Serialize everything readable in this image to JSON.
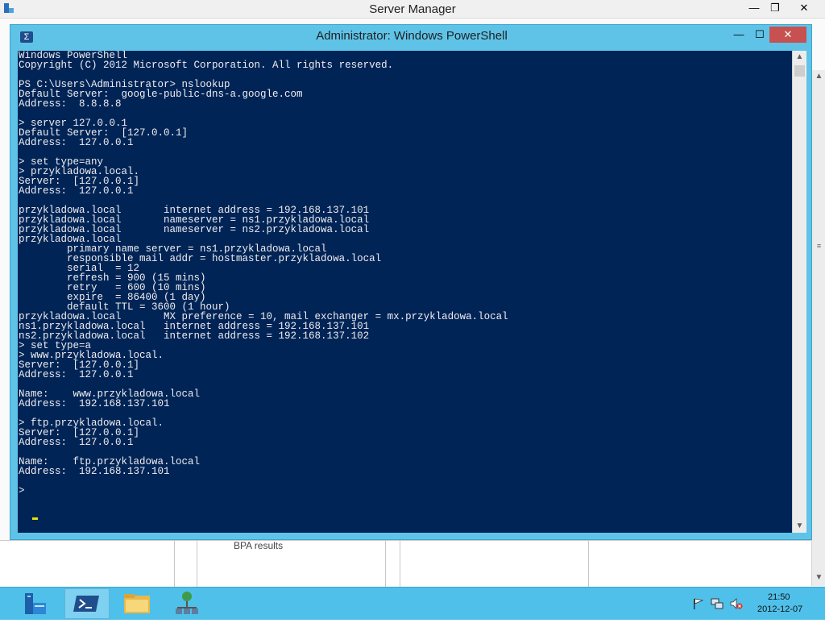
{
  "server_manager": {
    "title": "Server Manager",
    "minimize_glyph": "—",
    "restore_glyph": "❐",
    "close_glyph": "✕",
    "bpa_results": "BPA results"
  },
  "powershell": {
    "title": "Administrator: Windows PowerShell",
    "minimize_glyph": "—",
    "maximize_glyph": "☐",
    "close_glyph": "✕",
    "icon_glyph": "Σ",
    "console_lines": [
      "Windows PowerShell",
      "Copyright (C) 2012 Microsoft Corporation. All rights reserved.",
      "",
      "PS C:\\Users\\Administrator> nslookup",
      "Default Server:  google-public-dns-a.google.com",
      "Address:  8.8.8.8",
      "",
      "> server 127.0.0.1",
      "Default Server:  [127.0.0.1]",
      "Address:  127.0.0.1",
      "",
      "> set type=any",
      "> przykladowa.local.",
      "Server:  [127.0.0.1]",
      "Address:  127.0.0.1",
      "",
      "przykladowa.local       internet address = 192.168.137.101",
      "przykladowa.local       nameserver = ns1.przykladowa.local",
      "przykladowa.local       nameserver = ns2.przykladowa.local",
      "przykladowa.local",
      "        primary name server = ns1.przykladowa.local",
      "        responsible mail addr = hostmaster.przykladowa.local",
      "        serial  = 12",
      "        refresh = 900 (15 mins)",
      "        retry   = 600 (10 mins)",
      "        expire  = 86400 (1 day)",
      "        default TTL = 3600 (1 hour)",
      "przykladowa.local       MX preference = 10, mail exchanger = mx.przykladowa.local",
      "ns1.przykladowa.local   internet address = 192.168.137.101",
      "ns2.przykladowa.local   internet address = 192.168.137.102",
      "> set type=a",
      "> www.przykladowa.local.",
      "Server:  [127.0.0.1]",
      "Address:  127.0.0.1",
      "",
      "Name:    www.przykladowa.local",
      "Address:  192.168.137.101",
      "",
      "> ftp.przykladowa.local.",
      "Server:  [127.0.0.1]",
      "Address:  127.0.0.1",
      "",
      "Name:    ftp.przykladowa.local",
      "Address:  192.168.137.101",
      "",
      ">"
    ]
  },
  "taskbar": {
    "time": "21:50",
    "date": "2012-12-07",
    "icons": [
      "server-manager-icon",
      "powershell-icon",
      "file-explorer-icon",
      "network-icon"
    ],
    "tray_icons": [
      "flag-icon",
      "network-tray-icon",
      "speaker-muted-icon"
    ]
  },
  "colors": {
    "console_bg": "#012456",
    "console_text": "#eeedf0",
    "window_chrome": "#5fc3e8",
    "taskbar": "#4fc0ea",
    "close_button": "#c75050",
    "cursor": "#e6e000"
  }
}
